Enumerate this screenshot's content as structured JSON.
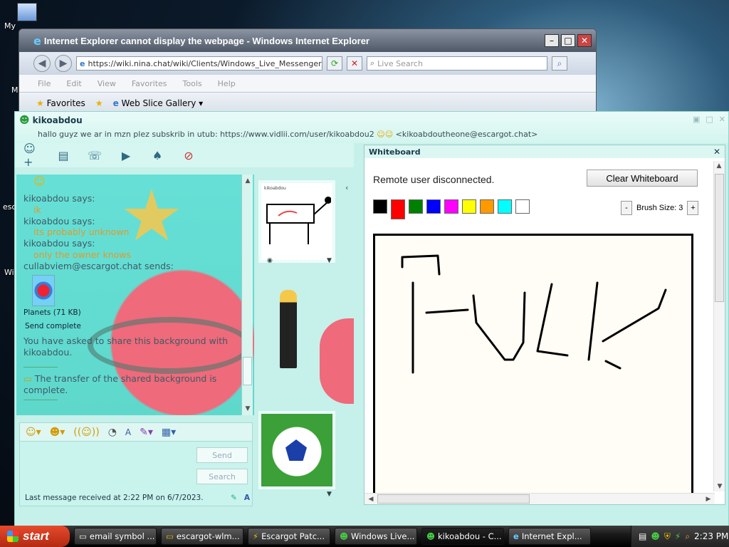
{
  "desktop": {
    "icon_labels": [
      "My",
      "M",
      "esc",
      "Wi"
    ]
  },
  "ie": {
    "title": "Internet Explorer cannot display the webpage - Windows Internet Explorer",
    "address": "https://wiki.nina.chat/wiki/Clients/Windows_Live_Messenger/Tu",
    "search_placeholder": "Live Search",
    "menus": [
      "File",
      "Edit",
      "View",
      "Favorites",
      "Tools",
      "Help"
    ],
    "favorites_label": "Favorites",
    "web_slice_label": "Web Slice Gallery"
  },
  "messenger": {
    "contact_name": "kikoabdou",
    "personal_message": "hallo guyz we ar in mzn plez subskrib in utub: https://www.vidlii.com/user/kikoabdou2",
    "contact_email": "<kikoabdoutheone@escargot.chat>",
    "chat": {
      "lines": [
        {
          "type": "says",
          "text": "kikoabdou says:"
        },
        {
          "type": "msg",
          "text": "ik"
        },
        {
          "type": "says",
          "text": "kikoabdou says:"
        },
        {
          "type": "msg",
          "text": "its probably unknown"
        },
        {
          "type": "says",
          "text": "kikoabdou says:"
        },
        {
          "type": "msg",
          "text": "only the owner knows"
        },
        {
          "type": "says",
          "text": "cullabviem@escargot.chat sends:"
        }
      ],
      "file_name": "Planets (71 KB)",
      "file_status": "Send complete",
      "share_notice": "You have asked to share this background with kikoabdou.",
      "transfer_notice": "The transfer of the shared background is complete."
    },
    "contact_pic_label": "kikoabdou",
    "send_label": "Send",
    "search_label": "Search",
    "status_text": "Last message received at 2:22 PM on 6/7/2023.",
    "whiteboard": {
      "title": "Whiteboard",
      "message": "Remote user disconnected.",
      "clear_label": "Clear Whiteboard",
      "brush_label": "Brush Size: 3",
      "colors": [
        "#000000",
        "#ff0000",
        "#008000",
        "#0000ff",
        "#ff00ff",
        "#ffff00",
        "#ff9900",
        "#00ffff",
        "#ffffff"
      ],
      "selected_color": "#ff0000"
    }
  },
  "taskbar": {
    "start_label": "start",
    "tasks": [
      {
        "label": "email symbol ...",
        "active": false
      },
      {
        "label": "escargot-wlm...",
        "active": false
      },
      {
        "label": "Escargot Patc...",
        "active": false
      },
      {
        "label": "Windows Live...",
        "active": false
      },
      {
        "label": "kikoabdou - C...",
        "active": true
      },
      {
        "label": "Internet Expl...",
        "active": false
      }
    ],
    "clock": "2:23 PM"
  }
}
